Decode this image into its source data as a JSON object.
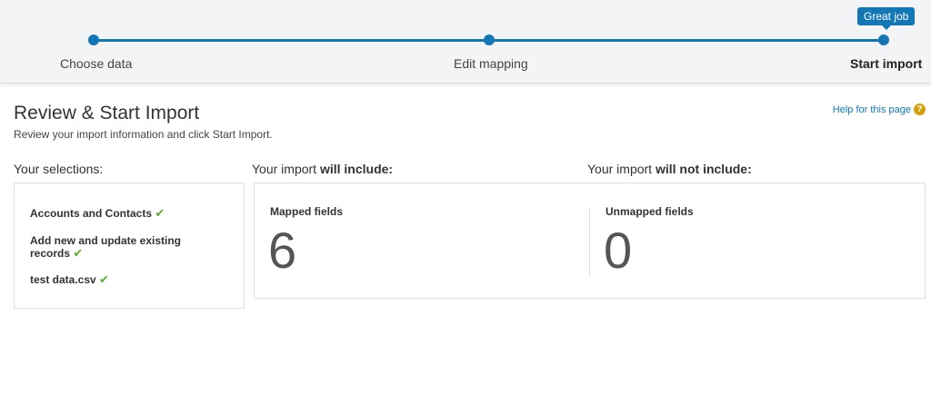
{
  "progress": {
    "tooltip": "Great job",
    "steps": [
      {
        "label": "Choose data"
      },
      {
        "label": "Edit mapping"
      },
      {
        "label": "Start import"
      }
    ]
  },
  "header": {
    "title": "Review & Start Import",
    "subtitle": "Review your import information and click Start Import.",
    "help_link": "Help for this page",
    "help_icon_glyph": "?"
  },
  "selections": {
    "heading": "Your selections:",
    "items": [
      "Accounts and Contacts",
      "Add new and update existing records",
      "test data.csv"
    ],
    "check_glyph": "✔"
  },
  "include": {
    "heading_prefix": "Your import ",
    "heading_bold": "will include:",
    "label": "Mapped fields",
    "count": "6"
  },
  "exclude": {
    "heading_prefix": "Your import ",
    "heading_bold": "will not include:",
    "label": "Unmapped fields",
    "count": "0"
  },
  "colors": {
    "accent": "#1377b5",
    "check": "#5ea832",
    "help_icon": "#d6a00b"
  }
}
